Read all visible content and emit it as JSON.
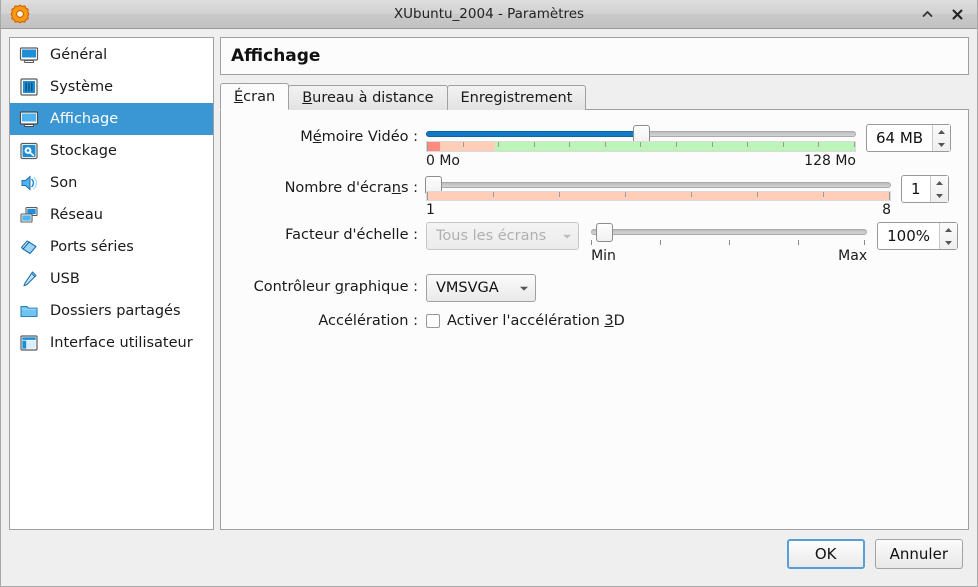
{
  "window": {
    "title": "XUbuntu_2004 - Paramètres",
    "icon": "vbox-gear-icon",
    "buttons": {
      "shade": "shade-up-icon",
      "close": "close-icon"
    }
  },
  "sidebar": {
    "items": [
      {
        "label": "Général",
        "icon": "monitor-icon",
        "selected": false
      },
      {
        "label": "Système",
        "icon": "motherboard-icon",
        "selected": false
      },
      {
        "label": "Affichage",
        "icon": "display-icon",
        "selected": true
      },
      {
        "label": "Stockage",
        "icon": "harddisk-icon",
        "selected": false
      },
      {
        "label": "Son",
        "icon": "speaker-icon",
        "selected": false
      },
      {
        "label": "Réseau",
        "icon": "network-icon",
        "selected": false
      },
      {
        "label": "Ports séries",
        "icon": "serial-port-icon",
        "selected": false
      },
      {
        "label": "USB",
        "icon": "usb-icon",
        "selected": false
      },
      {
        "label": "Dossiers partagés",
        "icon": "folder-icon",
        "selected": false
      },
      {
        "label": "Interface utilisateur",
        "icon": "user-interface-icon",
        "selected": false
      }
    ]
  },
  "pane": {
    "title": "Affichage",
    "tabs": [
      {
        "label": "Écran",
        "mnemonic": "É",
        "rest": "cran",
        "active": true
      },
      {
        "label": "Bureau à distance",
        "mnemonic": "B",
        "rest": "ureau à distance",
        "active": false
      },
      {
        "label": "Enregistrement",
        "mnemonic": "",
        "rest": "Enregistrement",
        "active": false
      }
    ]
  },
  "form": {
    "video_memory": {
      "label_pre": "M",
      "label_mn": "é",
      "label_post": "moire Vidéo :",
      "value": "64 MB",
      "slider_percent": 50,
      "min_label": "0 Mo",
      "max_label": "128 Mo",
      "warn_color": "#ff8a80",
      "caution_color": "#ffcdb8",
      "ok_color": "#bdf5b9",
      "fill_color": "#1278c8"
    },
    "monitor_count": {
      "label_pre": "Nombre d'écra",
      "label_mn": "n",
      "label_post": "s :",
      "value": "1",
      "slider_percent": 0,
      "min_label": "1",
      "max_label": "8",
      "bar_color": "#ffcdb8"
    },
    "scale_factor": {
      "label": "Facteur d'échelle :",
      "combo_value": "Tous les écrans",
      "combo_disabled": true,
      "value": "100%",
      "slider_percent": 2,
      "min_label": "Min",
      "max_label": "Max"
    },
    "graphics_controller": {
      "label_pre": "Contrôleur ",
      "label_mn": "g",
      "label_post": "raphique :",
      "value": "VMSVGA"
    },
    "acceleration": {
      "label": "Accélération :",
      "checkbox_label_pre": "Activer l'accélération ",
      "checkbox_label_mn": "3",
      "checkbox_label_post": "D",
      "checked": false
    }
  },
  "footer": {
    "ok": "OK",
    "cancel": "Annuler"
  }
}
